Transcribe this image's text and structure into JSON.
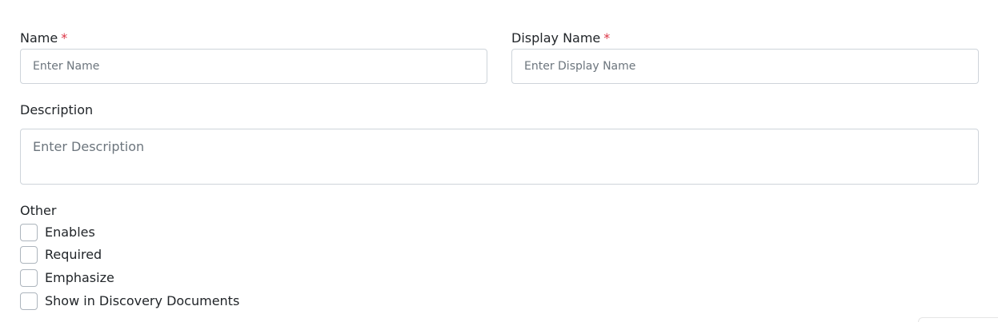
{
  "form": {
    "name": {
      "label": "Name",
      "required_mark": "*",
      "placeholder": "Enter Name",
      "value": ""
    },
    "display_name": {
      "label": "Display Name",
      "required_mark": "*",
      "placeholder": "Enter Display Name",
      "value": ""
    },
    "description": {
      "label": "Description",
      "placeholder": "Enter Description",
      "value": ""
    },
    "other": {
      "label": "Other",
      "options": [
        {
          "label": "Enables",
          "checked": false
        },
        {
          "label": "Required",
          "checked": false
        },
        {
          "label": "Emphasize",
          "checked": false
        },
        {
          "label": "Show in Discovery Documents",
          "checked": false
        }
      ]
    }
  },
  "colors": {
    "required_mark": "#dc3545",
    "border": "#ced4da",
    "placeholder": "#6c757d",
    "text": "#212529"
  }
}
